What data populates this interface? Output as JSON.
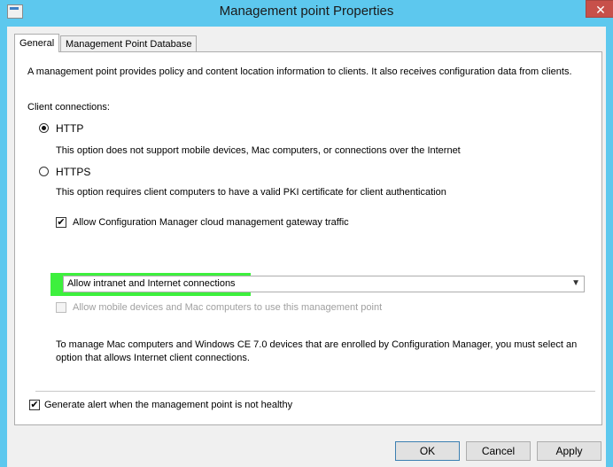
{
  "window": {
    "title": "Management point Properties",
    "close_label": "✕"
  },
  "tabs": [
    {
      "label": "General",
      "active": true
    },
    {
      "label": "Management Point Database",
      "active": false
    }
  ],
  "general": {
    "description": "A management point provides policy and content location information to clients.  It also receives configuration data from clients.",
    "client_connections_label": "Client connections:",
    "http": {
      "label": "HTTP",
      "selected": true,
      "note": "This option does not support mobile devices, Mac computers, or connections over the Internet"
    },
    "https": {
      "label": "HTTPS",
      "selected": false,
      "note": "This option requires client computers to have a valid PKI certificate for client authentication"
    },
    "cmg_traffic": {
      "label": "Allow Configuration Manager cloud management gateway traffic",
      "checked": true
    },
    "connection_select": {
      "value": "Allow intranet and Internet connections",
      "highlight_color": "#3df03d"
    },
    "mobile_mac": {
      "label": "Allow mobile devices and Mac computers to use this management point",
      "checked": false,
      "disabled": true
    },
    "mac_note_line1": "To manage Mac computers and Windows CE 7.0 devices that are enrolled by Configuration Manager, you must select an",
    "mac_note_line2": "option that allows Internet client connections.",
    "generate_alert": {
      "label": "Generate alert when the management point is not healthy",
      "checked": true
    }
  },
  "buttons": {
    "ok": "OK",
    "cancel": "Cancel",
    "apply": "Apply"
  },
  "colors": {
    "title_bar": "#5dc8ee",
    "close_button": "#c7504a",
    "dialog_bg": "#f0f0f0"
  },
  "icons": {
    "app": "properties-window-icon",
    "check": "✔",
    "dropdown": "chevron-down-icon"
  }
}
